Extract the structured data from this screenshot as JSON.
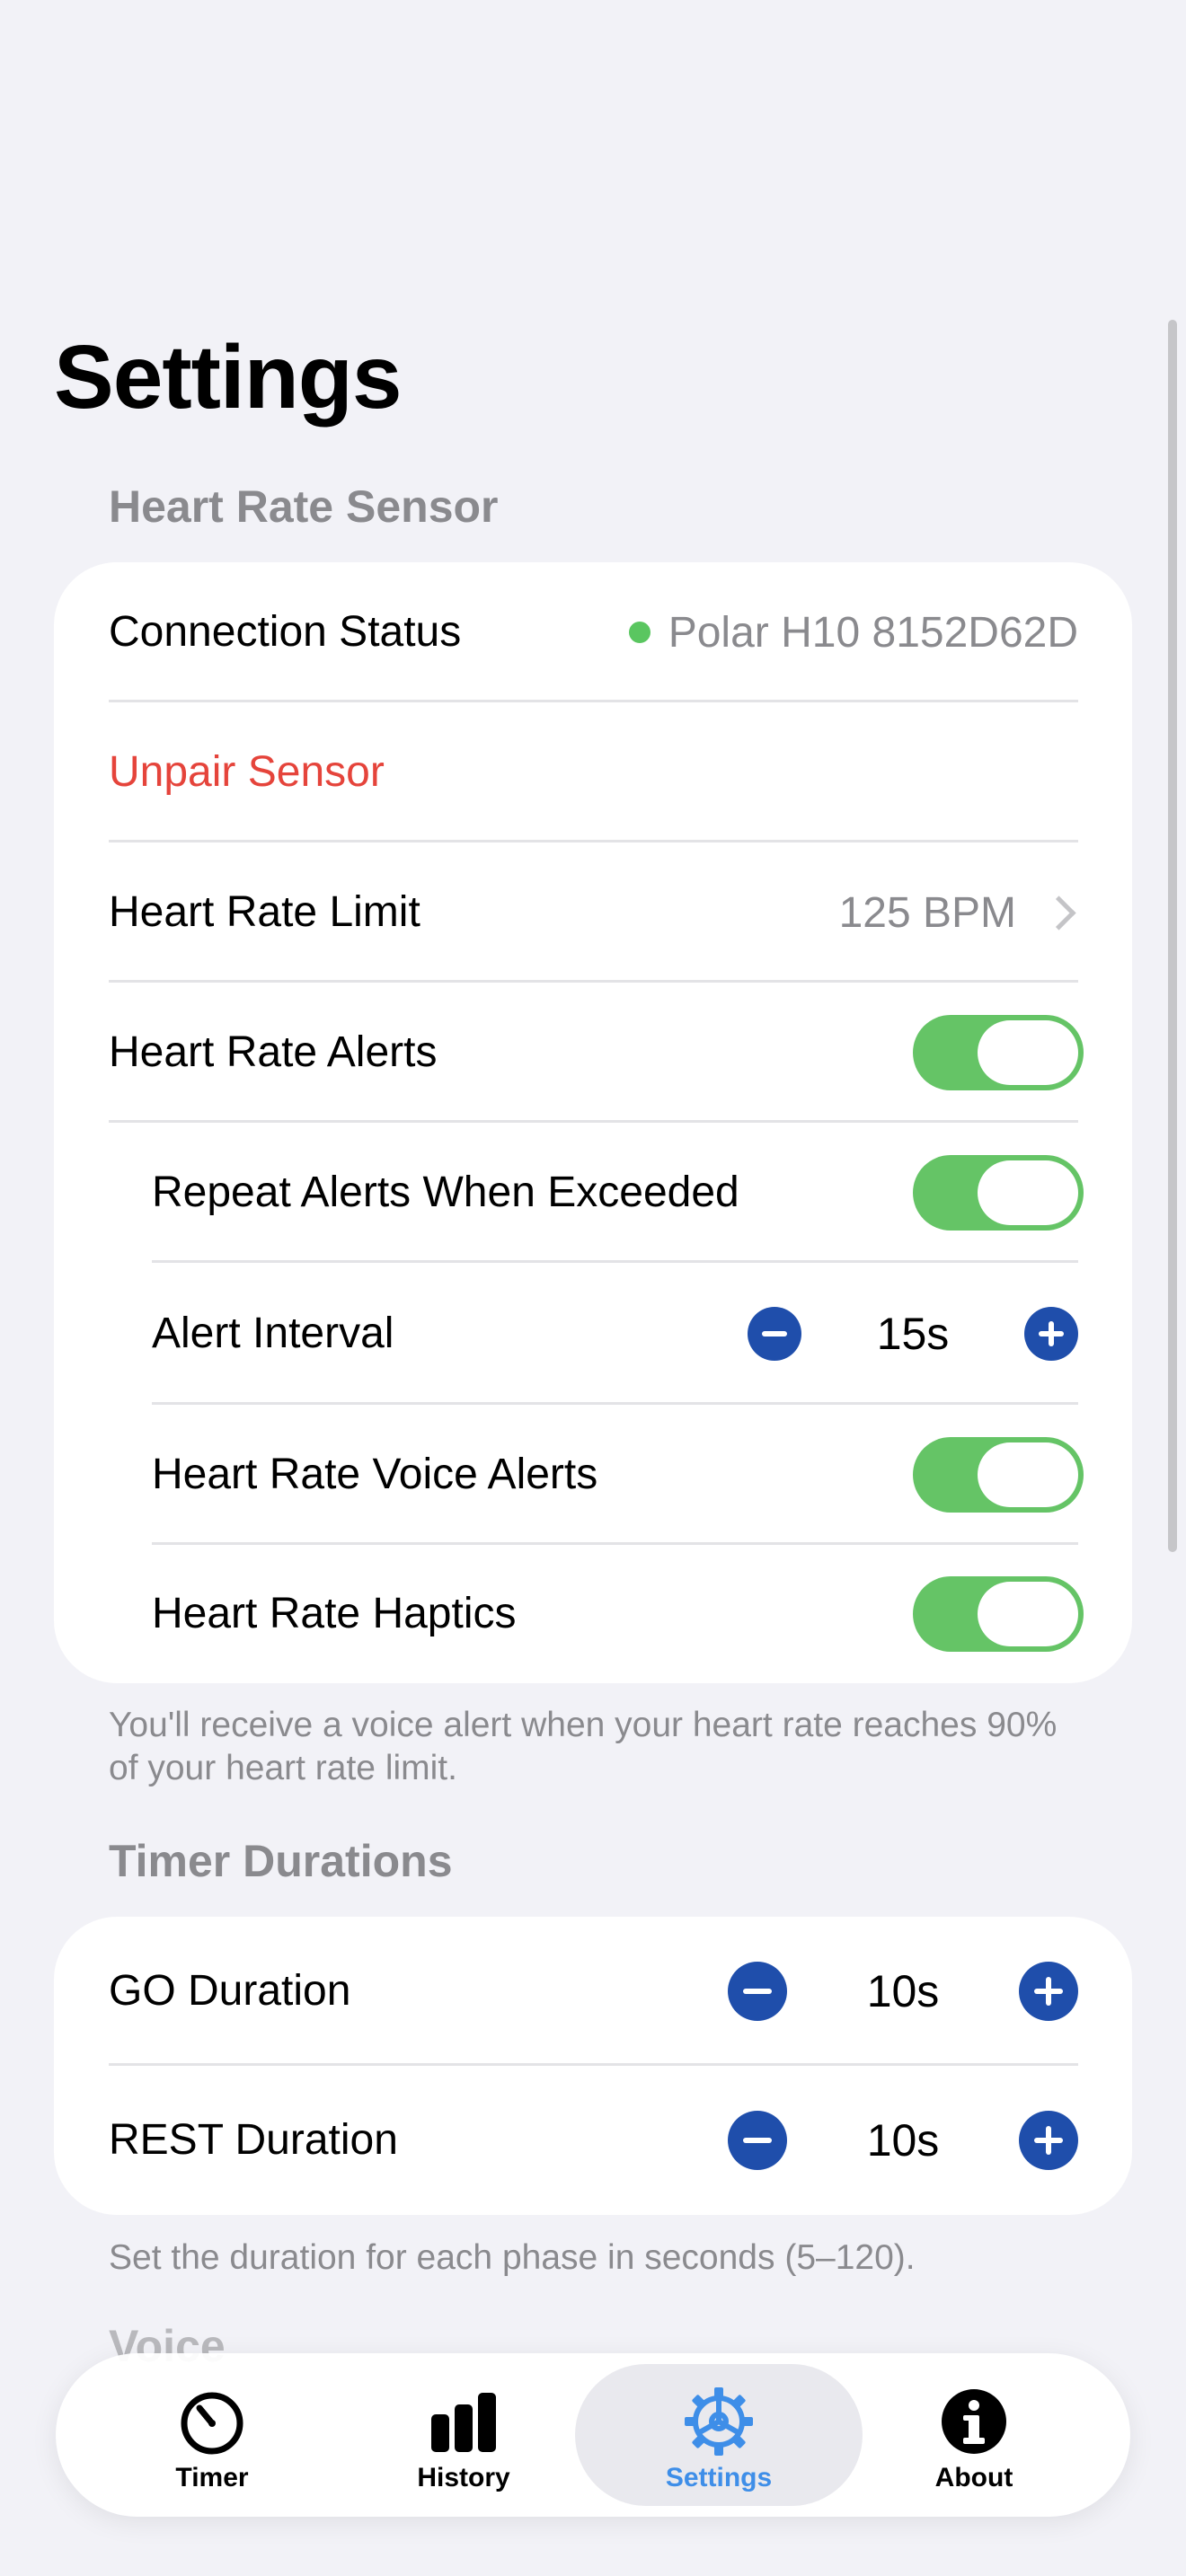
{
  "page": {
    "title": "Settings"
  },
  "heart_rate_sensor": {
    "header": "Heart Rate Sensor",
    "connection_status": {
      "label": "Connection Status",
      "value": "Polar H10 8152D62D",
      "status_color": "#5ac660"
    },
    "unpair": {
      "label": "Unpair Sensor"
    },
    "limit": {
      "label": "Heart Rate Limit",
      "value": "125 BPM"
    },
    "alerts": {
      "label": "Heart Rate Alerts",
      "on": true
    },
    "repeat_alerts": {
      "label": "Repeat Alerts When Exceeded",
      "on": true
    },
    "alert_interval": {
      "label": "Alert Interval",
      "value": "15s"
    },
    "voice_alerts": {
      "label": "Heart Rate Voice Alerts",
      "on": true
    },
    "haptics": {
      "label": "Heart Rate Haptics",
      "on": true
    },
    "footnote": "You'll receive a voice alert when your heart rate reaches 90% of your heart rate limit."
  },
  "timer_durations": {
    "header": "Timer Durations",
    "go": {
      "label": "GO Duration",
      "value": "10s"
    },
    "rest": {
      "label": "REST Duration",
      "value": "10s"
    },
    "footnote": "Set the duration for each phase in seconds (5–120)."
  },
  "voice_section": {
    "header": "Voice"
  },
  "tabbar": {
    "tabs": [
      {
        "label": "Timer",
        "icon": "timer-icon"
      },
      {
        "label": "History",
        "icon": "chart-bars-icon"
      },
      {
        "label": "Settings",
        "icon": "gear-icon",
        "active": true
      },
      {
        "label": "About",
        "icon": "info-icon"
      }
    ]
  },
  "colors": {
    "background": "#f2f2f7",
    "toggle_on": "#65c466",
    "stepper": "#1f4eab",
    "danger": "#e5443b",
    "active_tab": "#3e8ee8"
  }
}
